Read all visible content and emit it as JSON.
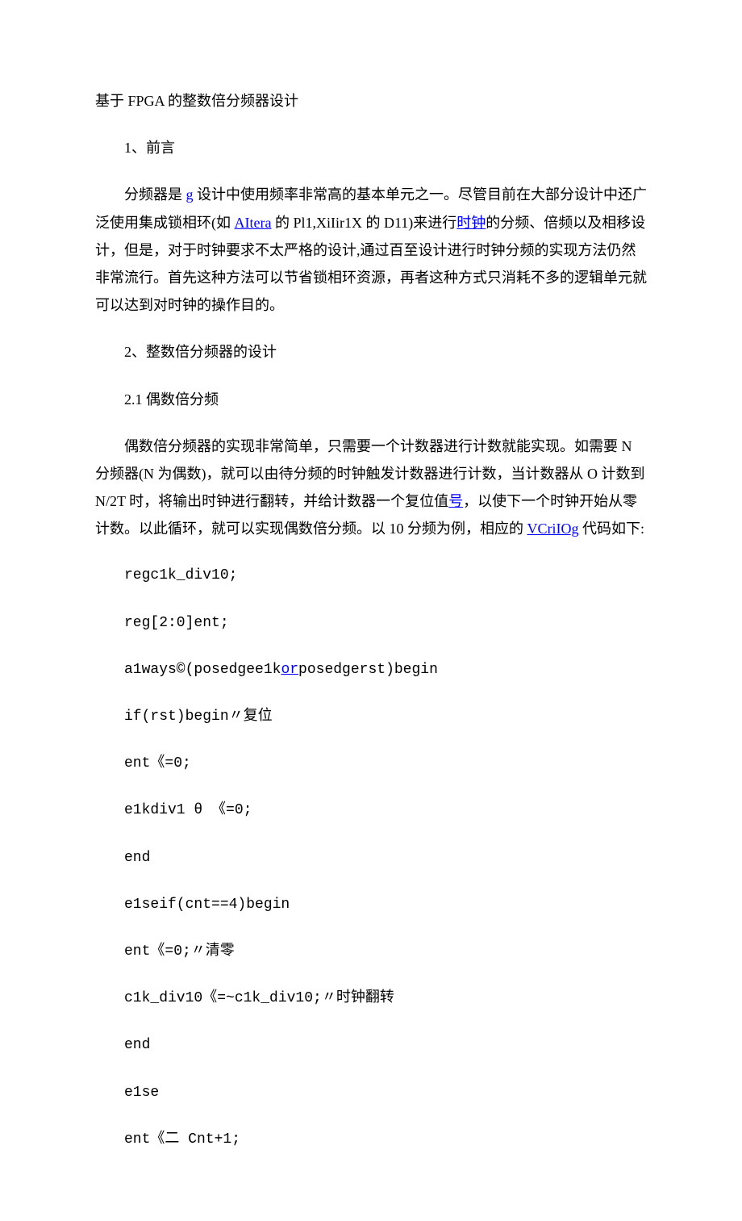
{
  "title": "基于 FPGA 的整数倍分频器设计",
  "sections": {
    "s1_title": "1、前言",
    "s1_p1_a": "分频器是 ",
    "s1_p1_link1": "g",
    "s1_p1_b": " 设计中使用频率非常高的基本单元之一。尽管目前在大部分设计中还广泛使用集成锁相环(如 ",
    "s1_p1_link2": "AItera",
    "s1_p1_c": " 的 Pl1,XiIir1X 的 D11)来进行",
    "s1_p1_link3": "时钟",
    "s1_p1_d": "的分频、倍频以及相移设计，但是，对于时钟要求不太严格的设计,通过百至设计进行时钟分频的实现方法仍然非常流行。首先这种方法可以节省锁相环资源，再者这种方式只消耗不多的逻辑单元就可以达到对时钟的操作目的。",
    "s2_title": "2、整数倍分频器的设计",
    "s21_title": "2.1 偶数倍分频",
    "s21_p1_a": "偶数倍分频器的实现非常简单，只需要一个计数器进行计数就能实现。如需要 N 分频器(N 为偶数)，就可以由待分频的时钟触发计数器进行计数，当计数器从 O 计数到 N/2T 时，将输出时钟进行翻转，并给计数器一个复位值",
    "s21_p1_link1": "号",
    "s21_p1_b": "，以使下一个时钟开始从零计数。以此循环，就可以实现偶数倍分频。以 10 分频为例，相应的 ",
    "s21_p1_link2": "VCriIOg",
    "s21_p1_c": " 代码如下:"
  },
  "code": {
    "l1": "regc1k_div10;",
    "l2": "reg[2:0]ent;",
    "l3a": "a1ways©(posedgee1k",
    "l3link": "or",
    "l3b": "posedgerst)begin",
    "l4": "if(rst)begin〃复位",
    "l5": "ent《=0;",
    "l6": "e1kdiv1 θ 《=0;",
    "l7": "end",
    "l8": "e1seif(cnt==4)begin",
    "l9": "ent《=0;〃清零",
    "l10": "c1k_div10《=~c1k_div10;〃时钟翻转",
    "l11": "end",
    "l12": "e1se",
    "l13": "ent《二 Cnt+1;"
  }
}
